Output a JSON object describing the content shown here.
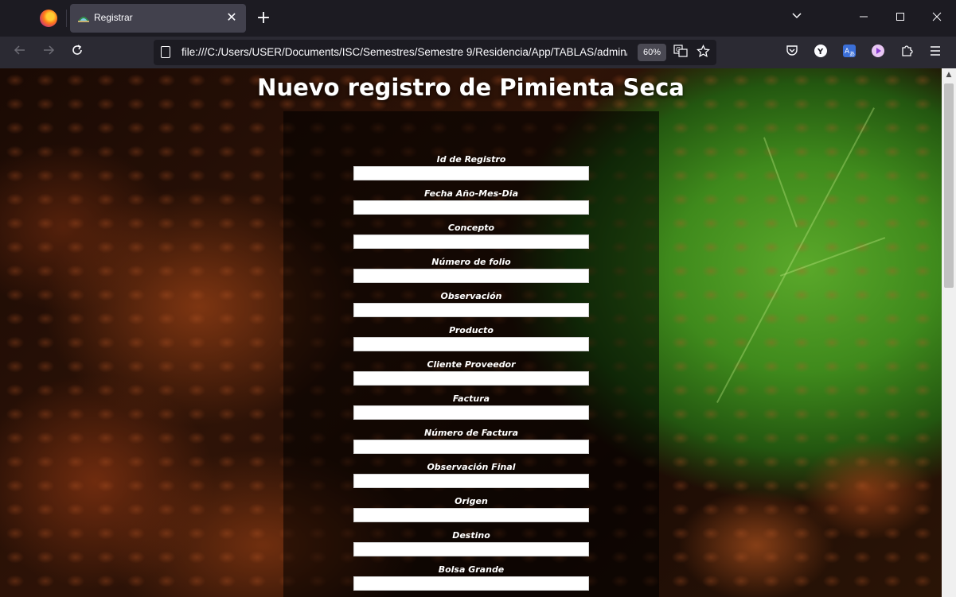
{
  "browser": {
    "tab_title": "Registrar",
    "tab_close": "✕",
    "new_tab": "+",
    "url": "file:///C:/Users/USER/Documents/ISC/Semestres/Semestre 9/Residencia/App/TABLAS/admin/P",
    "zoom": "60%",
    "icons": {
      "back": "back-arrow-icon",
      "forward": "forward-arrow-icon",
      "reload": "reload-icon",
      "page": "page-icon",
      "translate": "translate-icon",
      "bookmark": "star-icon",
      "pocket": "pocket-icon",
      "account": "account-icon",
      "translator_ext": "translator-extension-icon",
      "media_ext": "media-extension-icon",
      "extensions": "puzzle-icon",
      "menu": "hamburger-menu-icon"
    }
  },
  "page": {
    "title": "Nuevo registro de Pimienta Seca",
    "fields": [
      {
        "label": "Id de Registro",
        "value": ""
      },
      {
        "label": "Fecha Año-Mes-Dia",
        "value": ""
      },
      {
        "label": "Concepto",
        "value": ""
      },
      {
        "label": "Número de folio",
        "value": ""
      },
      {
        "label": "Observación",
        "value": ""
      },
      {
        "label": "Producto",
        "value": ""
      },
      {
        "label": "Cliente Proveedor",
        "value": ""
      },
      {
        "label": "Factura",
        "value": ""
      },
      {
        "label": "Número de Factura",
        "value": ""
      },
      {
        "label": "Observación Final",
        "value": ""
      },
      {
        "label": "Origen",
        "value": ""
      },
      {
        "label": "Destino",
        "value": ""
      },
      {
        "label": "Bolsa Grande",
        "value": ""
      }
    ]
  },
  "colors": {
    "chrome_dark": "#1c1b22",
    "toolbar": "#2b2a33",
    "tab_active": "#42414d",
    "text_light": "#fbfbfe"
  }
}
